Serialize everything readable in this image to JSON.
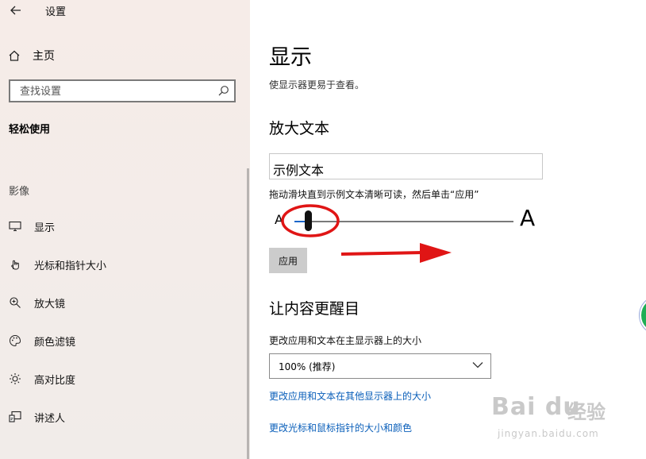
{
  "window": {
    "title": "设置"
  },
  "sidebar": {
    "home_label": "主页",
    "search_placeholder": "查找设置",
    "category": "轻松使用",
    "section_vision": "影像",
    "items": [
      {
        "label": "显示",
        "icon": "monitor-icon"
      },
      {
        "label": "光标和指针大小",
        "icon": "pointer-icon"
      },
      {
        "label": "放大镜",
        "icon": "magnifier-icon"
      },
      {
        "label": "颜色滤镜",
        "icon": "palette-icon"
      },
      {
        "label": "高对比度",
        "icon": "brightness-icon"
      },
      {
        "label": "讲述人",
        "icon": "narrator-icon"
      }
    ]
  },
  "main": {
    "title": "显示",
    "subtitle": "使显示器更易于查看。",
    "enlarge_text": {
      "heading": "放大文本",
      "sample_text": "示例文本",
      "hint": "拖动滑块直到示例文本清晰可读，然后单击“应用”",
      "small_a": "A",
      "large_a": "A",
      "slider_value_fraction": 0.06,
      "apply_label": "应用"
    },
    "make_bigger": {
      "heading": "让内容更醒目",
      "scale_label": "更改应用和文本在主显示器上的大小",
      "scale_value": "100% (推荐)",
      "link1": "更改应用和文本在其他显示器上的大小",
      "link2": "更改光标和鼠标指针的大小和颜色"
    }
  },
  "colors": {
    "accent": "#1a66c9",
    "link": "#0a5fba",
    "annotation_red": "#e01515",
    "sidebar_bg": "#f4ece9"
  },
  "watermark": {
    "logo": "Bai du",
    "text": "经验",
    "url": "jingyan.baidu.com"
  }
}
